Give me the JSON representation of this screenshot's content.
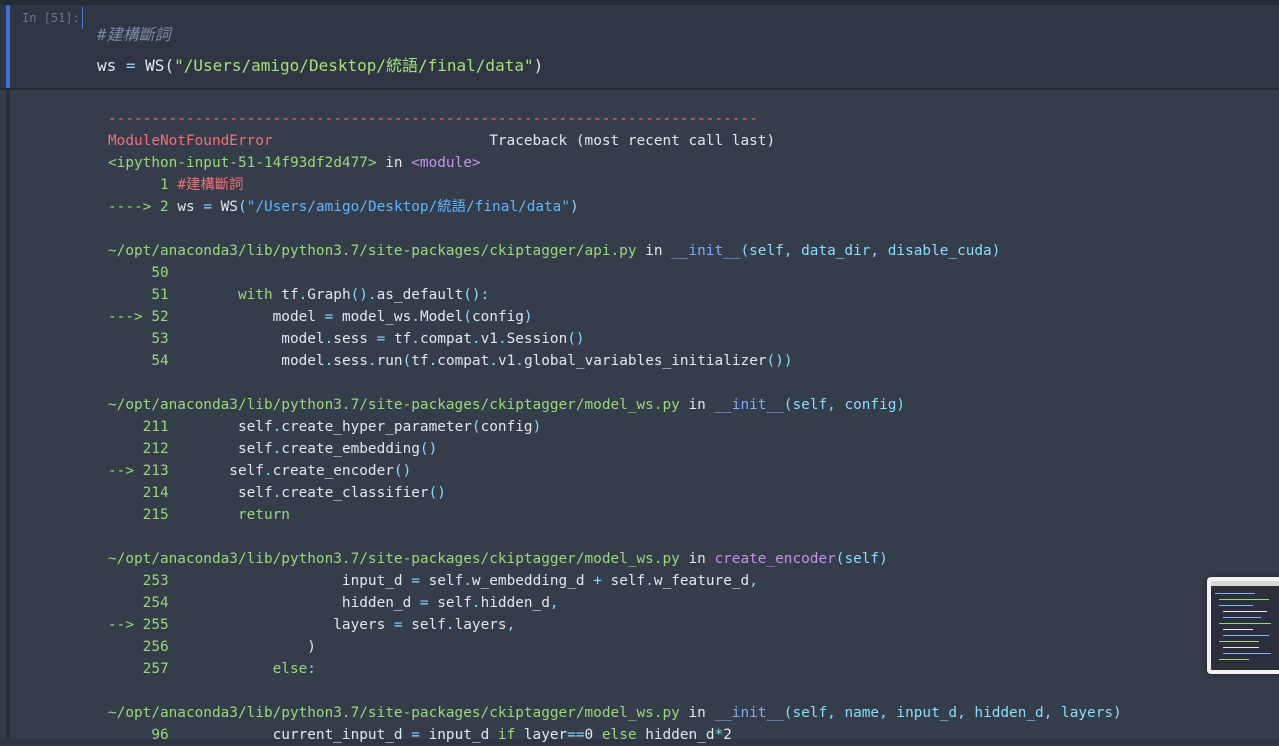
{
  "cell": {
    "prompt": "In [51]:",
    "comment": "#建構斷詞",
    "code": {
      "lhs": "ws",
      "op": " = ",
      "fn": "WS(",
      "str": "\"/Users/amigo/Desktop/統語/final/data\"",
      "close": ")"
    }
  },
  "traceback": [
    [
      {
        "c": "t-red",
        "t": "---------------------------------------------------------------------------"
      }
    ],
    [
      {
        "c": "t-red",
        "t": "ModuleNotFoundError"
      },
      {
        "c": "t-white",
        "t": "                         Traceback (most recent call last)"
      }
    ],
    [
      {
        "c": "t-green",
        "t": "<ipython-input-51-14f93df2d477>"
      },
      {
        "c": "t-white",
        "t": " in "
      },
      {
        "c": "t-purple",
        "t": "<module>"
      }
    ],
    [
      {
        "c": "t-green",
        "t": "      1 "
      },
      {
        "c": "t-red",
        "t": "#建構斷詞"
      }
    ],
    [
      {
        "c": "t-green",
        "t": "----> 2 "
      },
      {
        "c": "t-white",
        "t": "ws "
      },
      {
        "c": "t-teal",
        "t": "="
      },
      {
        "c": "t-white",
        "t": " WS"
      },
      {
        "c": "t-teal",
        "t": "("
      },
      {
        "c": "t-cyan",
        "t": "\"/Users/amigo/Desktop/統語/final/data\""
      },
      {
        "c": "t-teal",
        "t": ")"
      }
    ],
    [
      {
        "c": "t-white",
        "t": ""
      }
    ],
    [
      {
        "c": "t-green",
        "t": "~/opt/anaconda3/lib/python3.7/site-packages/ckiptagger/api.py"
      },
      {
        "c": "t-white",
        "t": " in "
      },
      {
        "c": "t-blue",
        "t": "__init__"
      },
      {
        "c": "t-teal",
        "t": "(self, data_dir, disable_cuda)"
      }
    ],
    [
      {
        "c": "t-green",
        "t": "     50"
      }
    ],
    [
      {
        "c": "t-green",
        "t": "     51 "
      },
      {
        "c": "t-white",
        "t": "       "
      },
      {
        "c": "t-green",
        "t": "with"
      },
      {
        "c": "t-white",
        "t": " tf"
      },
      {
        "c": "t-teal",
        "t": "."
      },
      {
        "c": "t-white",
        "t": "Graph"
      },
      {
        "c": "t-teal",
        "t": "()."
      },
      {
        "c": "t-white",
        "t": "as_default"
      },
      {
        "c": "t-teal",
        "t": "():"
      }
    ],
    [
      {
        "c": "t-green",
        "t": "---> 52 "
      },
      {
        "c": "t-white",
        "t": "           model "
      },
      {
        "c": "t-teal",
        "t": "="
      },
      {
        "c": "t-white",
        "t": " model_ws"
      },
      {
        "c": "t-teal",
        "t": "."
      },
      {
        "c": "t-white",
        "t": "Model"
      },
      {
        "c": "t-teal",
        "t": "("
      },
      {
        "c": "t-white",
        "t": "config"
      },
      {
        "c": "t-teal",
        "t": ")"
      }
    ],
    [
      {
        "c": "t-green",
        "t": "     53 "
      },
      {
        "c": "t-white",
        "t": "            model"
      },
      {
        "c": "t-teal",
        "t": "."
      },
      {
        "c": "t-white",
        "t": "sess "
      },
      {
        "c": "t-teal",
        "t": "="
      },
      {
        "c": "t-white",
        "t": " tf"
      },
      {
        "c": "t-teal",
        "t": "."
      },
      {
        "c": "t-white",
        "t": "compat"
      },
      {
        "c": "t-teal",
        "t": "."
      },
      {
        "c": "t-white",
        "t": "v1"
      },
      {
        "c": "t-teal",
        "t": "."
      },
      {
        "c": "t-white",
        "t": "Session"
      },
      {
        "c": "t-teal",
        "t": "()"
      }
    ],
    [
      {
        "c": "t-green",
        "t": "     54 "
      },
      {
        "c": "t-white",
        "t": "            model"
      },
      {
        "c": "t-teal",
        "t": "."
      },
      {
        "c": "t-white",
        "t": "sess"
      },
      {
        "c": "t-teal",
        "t": "."
      },
      {
        "c": "t-white",
        "t": "run"
      },
      {
        "c": "t-teal",
        "t": "("
      },
      {
        "c": "t-white",
        "t": "tf"
      },
      {
        "c": "t-teal",
        "t": "."
      },
      {
        "c": "t-white",
        "t": "compat"
      },
      {
        "c": "t-teal",
        "t": "."
      },
      {
        "c": "t-white",
        "t": "v1"
      },
      {
        "c": "t-teal",
        "t": "."
      },
      {
        "c": "t-white",
        "t": "global_variables_initializer"
      },
      {
        "c": "t-teal",
        "t": "())"
      }
    ],
    [
      {
        "c": "t-white",
        "t": ""
      }
    ],
    [
      {
        "c": "t-green",
        "t": "~/opt/anaconda3/lib/python3.7/site-packages/ckiptagger/model_ws.py"
      },
      {
        "c": "t-white",
        "t": " in "
      },
      {
        "c": "t-blue",
        "t": "__init__"
      },
      {
        "c": "t-teal",
        "t": "(self, config)"
      }
    ],
    [
      {
        "c": "t-green",
        "t": "    211 "
      },
      {
        "c": "t-white",
        "t": "       self"
      },
      {
        "c": "t-teal",
        "t": "."
      },
      {
        "c": "t-white",
        "t": "create_hyper_parameter"
      },
      {
        "c": "t-teal",
        "t": "("
      },
      {
        "c": "t-white",
        "t": "config"
      },
      {
        "c": "t-teal",
        "t": ")"
      }
    ],
    [
      {
        "c": "t-green",
        "t": "    212 "
      },
      {
        "c": "t-white",
        "t": "       self"
      },
      {
        "c": "t-teal",
        "t": "."
      },
      {
        "c": "t-white",
        "t": "create_embedding"
      },
      {
        "c": "t-teal",
        "t": "()"
      }
    ],
    [
      {
        "c": "t-green",
        "t": "--> 213 "
      },
      {
        "c": "t-white",
        "t": "      self"
      },
      {
        "c": "t-teal",
        "t": "."
      },
      {
        "c": "t-white",
        "t": "create_encoder"
      },
      {
        "c": "t-teal",
        "t": "()"
      }
    ],
    [
      {
        "c": "t-green",
        "t": "    214 "
      },
      {
        "c": "t-white",
        "t": "       self"
      },
      {
        "c": "t-teal",
        "t": "."
      },
      {
        "c": "t-white",
        "t": "create_classifier"
      },
      {
        "c": "t-teal",
        "t": "()"
      }
    ],
    [
      {
        "c": "t-green",
        "t": "    215 "
      },
      {
        "c": "t-white",
        "t": "       "
      },
      {
        "c": "t-green",
        "t": "return"
      }
    ],
    [
      {
        "c": "t-white",
        "t": ""
      }
    ],
    [
      {
        "c": "t-green",
        "t": "~/opt/anaconda3/lib/python3.7/site-packages/ckiptagger/model_ws.py"
      },
      {
        "c": "t-white",
        "t": " in "
      },
      {
        "c": "t-purple",
        "t": "create_encoder"
      },
      {
        "c": "t-teal",
        "t": "(self)"
      }
    ],
    [
      {
        "c": "t-green",
        "t": "    253 "
      },
      {
        "c": "t-white",
        "t": "                   input_d "
      },
      {
        "c": "t-teal",
        "t": "="
      },
      {
        "c": "t-white",
        "t": " self"
      },
      {
        "c": "t-teal",
        "t": "."
      },
      {
        "c": "t-white",
        "t": "w_embedding_d "
      },
      {
        "c": "t-teal",
        "t": "+"
      },
      {
        "c": "t-white",
        "t": " self"
      },
      {
        "c": "t-teal",
        "t": "."
      },
      {
        "c": "t-white",
        "t": "w_feature_d"
      },
      {
        "c": "t-teal",
        "t": ","
      }
    ],
    [
      {
        "c": "t-green",
        "t": "    254 "
      },
      {
        "c": "t-white",
        "t": "                   hidden_d "
      },
      {
        "c": "t-teal",
        "t": "="
      },
      {
        "c": "t-white",
        "t": " self"
      },
      {
        "c": "t-teal",
        "t": "."
      },
      {
        "c": "t-white",
        "t": "hidden_d"
      },
      {
        "c": "t-teal",
        "t": ","
      }
    ],
    [
      {
        "c": "t-green",
        "t": "--> 255 "
      },
      {
        "c": "t-white",
        "t": "                  layers "
      },
      {
        "c": "t-teal",
        "t": "="
      },
      {
        "c": "t-white",
        "t": " self"
      },
      {
        "c": "t-teal",
        "t": "."
      },
      {
        "c": "t-white",
        "t": "layers"
      },
      {
        "c": "t-teal",
        "t": ","
      }
    ],
    [
      {
        "c": "t-green",
        "t": "    256 "
      },
      {
        "c": "t-white",
        "t": "               )"
      }
    ],
    [
      {
        "c": "t-green",
        "t": "    257 "
      },
      {
        "c": "t-white",
        "t": "           "
      },
      {
        "c": "t-green",
        "t": "else"
      },
      {
        "c": "t-teal",
        "t": ":"
      }
    ],
    [
      {
        "c": "t-white",
        "t": ""
      }
    ],
    [
      {
        "c": "t-green",
        "t": "~/opt/anaconda3/lib/python3.7/site-packages/ckiptagger/model_ws.py"
      },
      {
        "c": "t-white",
        "t": " in "
      },
      {
        "c": "t-blue",
        "t": "__init__"
      },
      {
        "c": "t-teal",
        "t": "(self, name, input_d, hidden_d, layers)"
      }
    ],
    [
      {
        "c": "t-green",
        "t": "     96 "
      },
      {
        "c": "t-white",
        "t": "           current_input_d "
      },
      {
        "c": "t-teal",
        "t": "="
      },
      {
        "c": "t-white",
        "t": " input_d "
      },
      {
        "c": "t-green",
        "t": "if"
      },
      {
        "c": "t-white",
        "t": " layer"
      },
      {
        "c": "t-teal",
        "t": "=="
      },
      {
        "c": "t-white",
        "t": "0 "
      },
      {
        "c": "t-green",
        "t": "else"
      },
      {
        "c": "t-white",
        "t": " hidden_d"
      },
      {
        "c": "t-teal",
        "t": "*"
      },
      {
        "c": "t-white",
        "t": "2"
      }
    ]
  ]
}
